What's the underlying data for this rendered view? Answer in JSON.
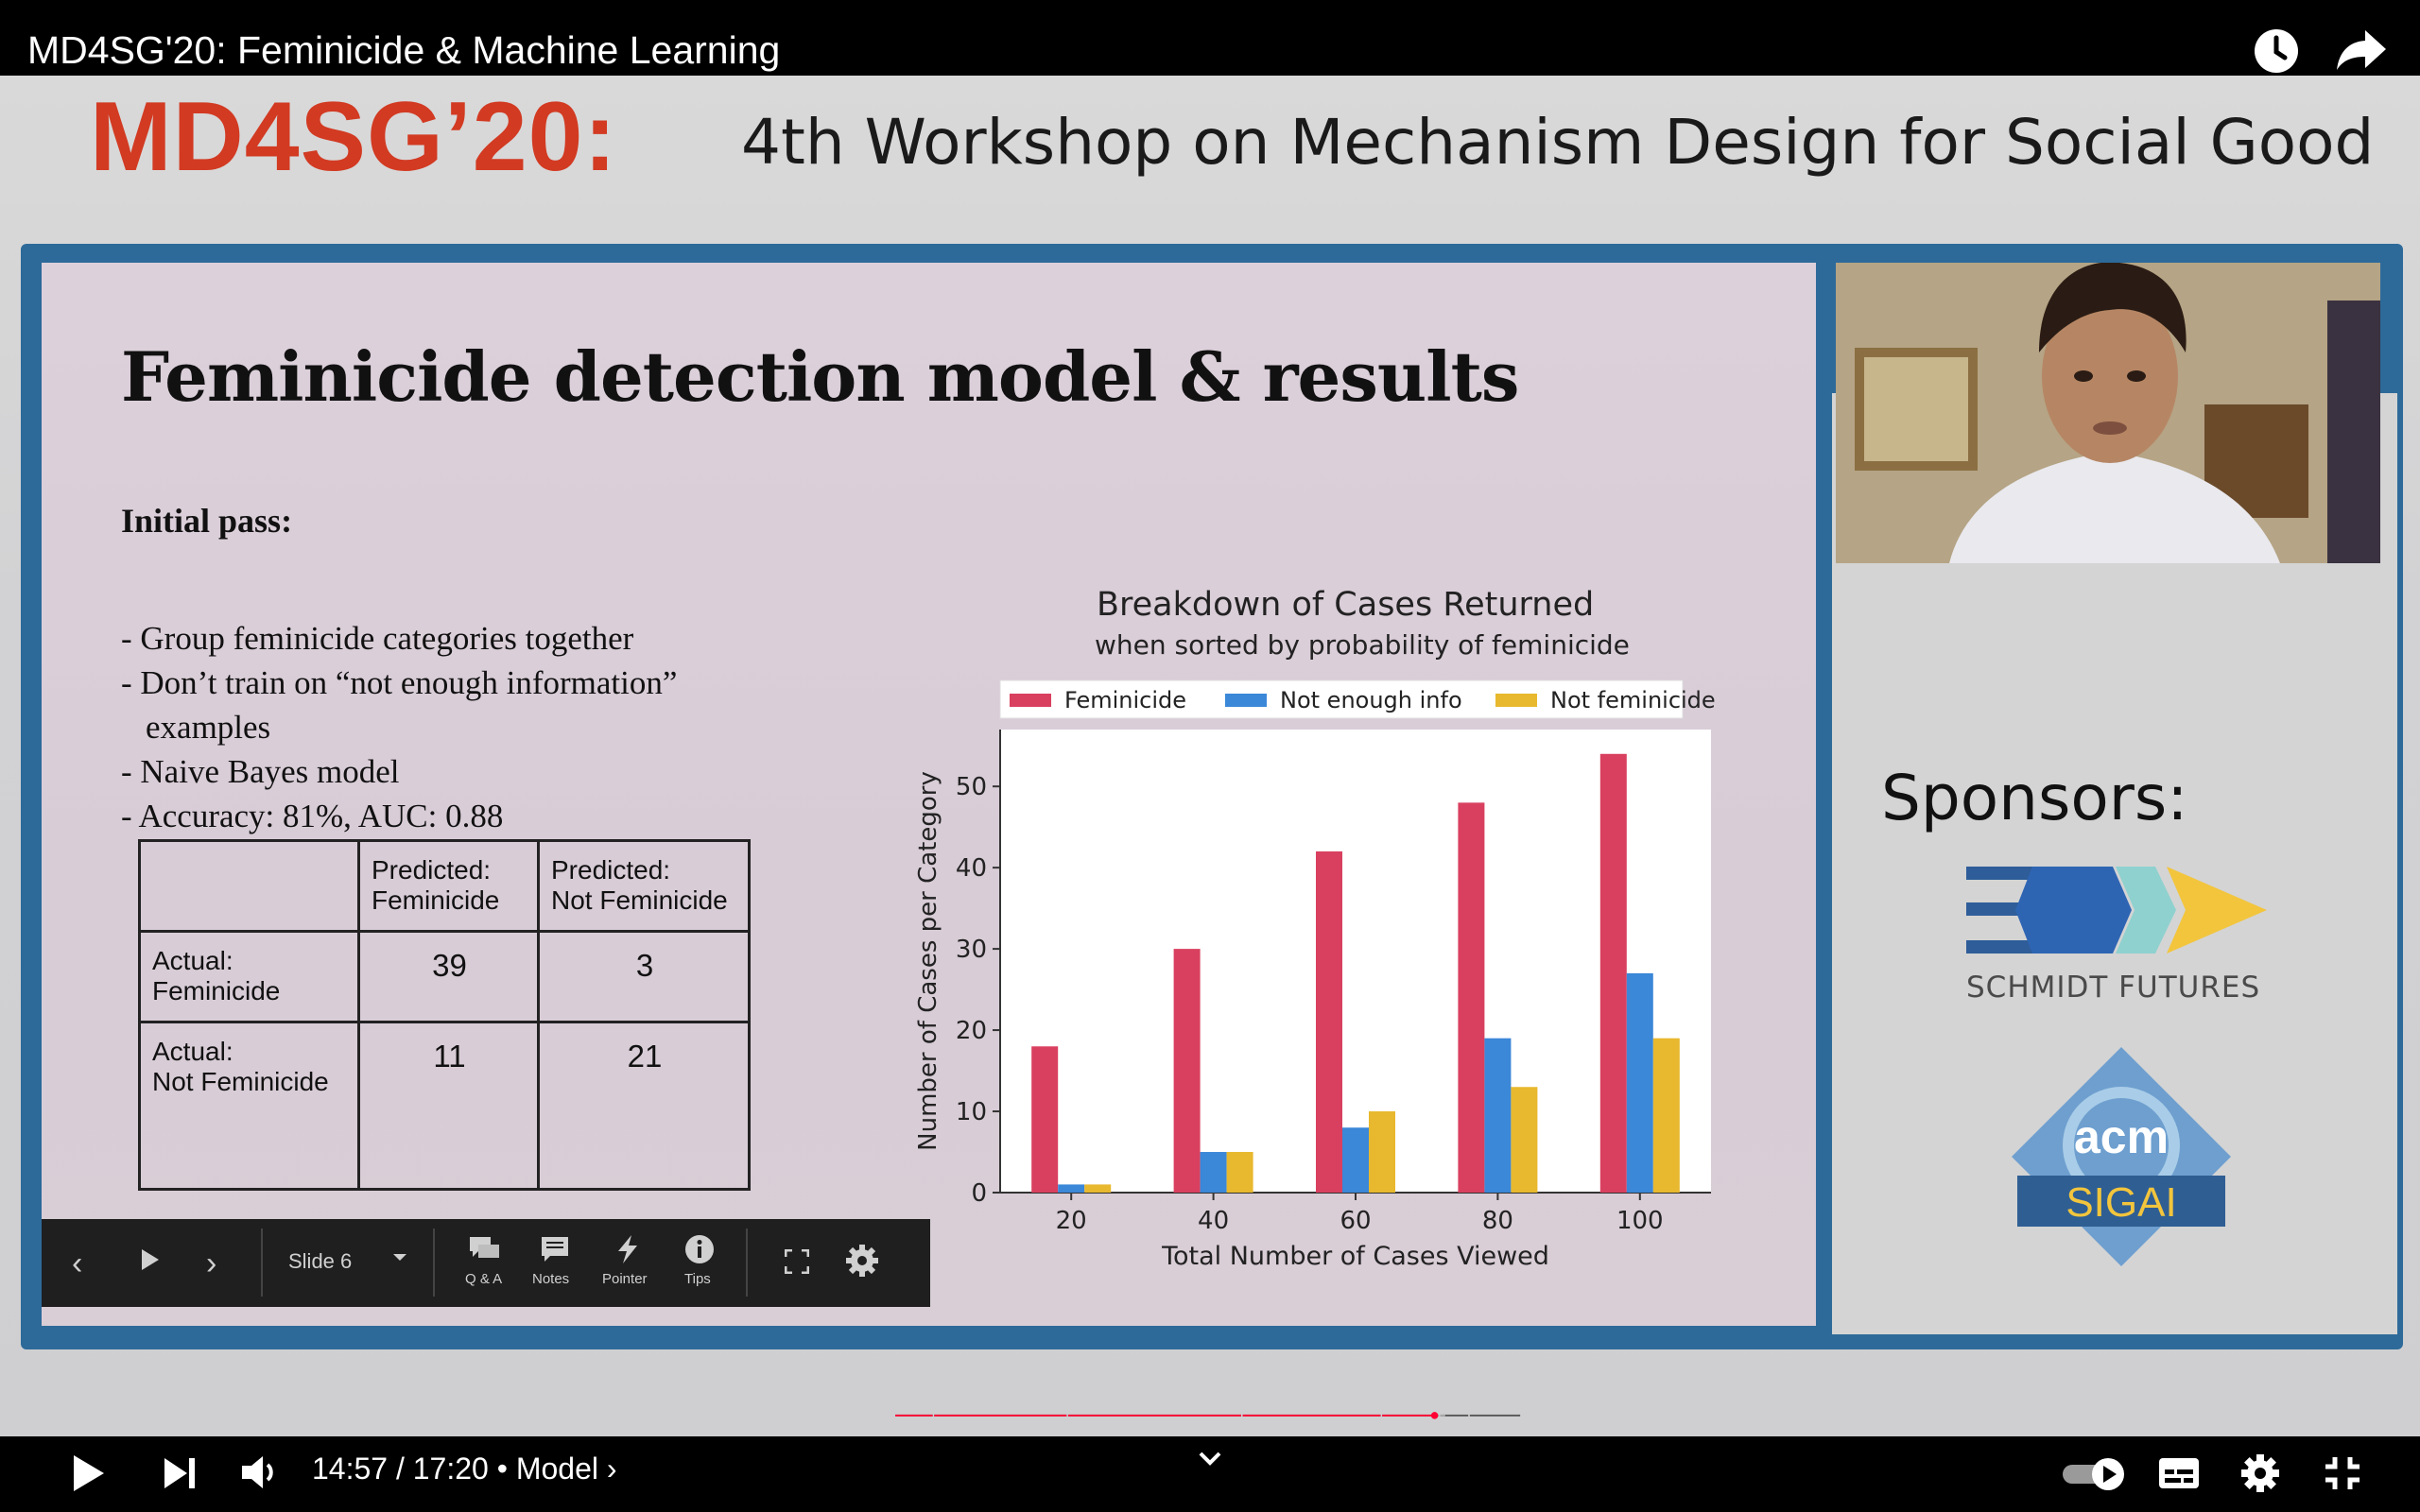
{
  "top_bar": {
    "video_title": "MD4SG'20: Feminicide & Machine Learning",
    "icons": [
      "watch-later-icon",
      "share-icon"
    ]
  },
  "video": {
    "header_brand": "MD4SG’20:",
    "header_workshop": "4th Workshop on Mechanism Design for Social Good",
    "slide": {
      "title": "Feminicide detection model & results",
      "pass_heading": "Initial pass:",
      "bullets": [
        "- Group feminicide categories together",
        "- Don’t train on “not enough information”",
        "examples",
        "- Naive Bayes model",
        "- Accuracy: 81%, AUC: 0.88"
      ],
      "table": {
        "header_row": [
          "",
          "Predicted:\nFeminicide",
          "Predicted:\nNot Feminicide"
        ],
        "rows": [
          {
            "label": "Actual:\nFeminicide",
            "values": [
              "39",
              "3"
            ]
          },
          {
            "label": "Actual:\nNot Feminicide",
            "values": [
              "11",
              "21"
            ]
          }
        ]
      },
      "toolbar": {
        "slide_label": "Slide 6",
        "qa_label": "Q & A",
        "notes_label": "Notes",
        "pointer_label": "Pointer",
        "tips_label": "Tips"
      }
    },
    "sponsors": {
      "label": "Sponsors:",
      "schmidt_text": "SCHMIDT FUTURES",
      "acm_text": "acm",
      "sigai_text": "SIGAI"
    }
  },
  "chart_data": {
    "type": "bar",
    "title": "Breakdown of Cases Returned",
    "subtitle": "when sorted by probability of feminicide",
    "xlabel": "Total Number of Cases Viewed",
    "ylabel": "Number of Cases per Category",
    "categories": [
      "20",
      "40",
      "60",
      "80",
      "100"
    ],
    "ylim": [
      0,
      57
    ],
    "yticks": [
      "0",
      "10",
      "20",
      "30",
      "40",
      "50"
    ],
    "legend_position": "top",
    "series": [
      {
        "name": "Feminicide",
        "color": "#d9405f",
        "values": [
          18,
          30,
          42,
          48,
          54
        ]
      },
      {
        "name": "Not enough info",
        "color": "#3b87d8",
        "values": [
          1,
          5,
          8,
          19,
          27
        ]
      },
      {
        "name": "Not feminicide",
        "color": "#e8b82e",
        "values": [
          1,
          5,
          10,
          13,
          19
        ]
      }
    ]
  },
  "player": {
    "time_text": "14:57 / 17:20 • Model ›",
    "progress_fraction": 0.862,
    "buffer_fraction": 0.879,
    "accent_color": "#ff0033"
  }
}
